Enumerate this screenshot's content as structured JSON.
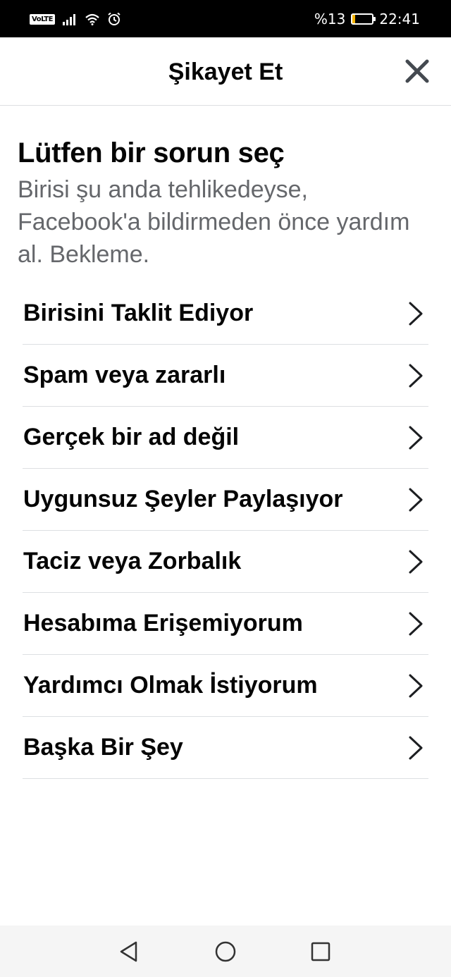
{
  "status_bar": {
    "volte": "VoLTE",
    "battery_text": "%13",
    "battery_level": 0.13,
    "time": "22:41",
    "icons": [
      "signal-icon",
      "wifi-icon",
      "alarm-icon",
      "battery-icon"
    ]
  },
  "header": {
    "title": "Şikayet Et",
    "close_icon": "close-icon"
  },
  "intro": {
    "title": "Lütfen bir sorun seç",
    "subtitle": "Birisi şu anda tehlikedeyse, Facebook'a bildirmeden önce yardım al. Bekleme."
  },
  "options": [
    {
      "label": "Birisini Taklit Ediyor"
    },
    {
      "label": "Spam veya zararlı"
    },
    {
      "label": "Gerçek bir ad değil"
    },
    {
      "label": "Uygunsuz Şeyler Paylaşıyor"
    },
    {
      "label": "Taciz veya Zorbalık"
    },
    {
      "label": "Hesabıma Erişemiyorum"
    },
    {
      "label": "Yardımcı Olmak İstiyorum"
    },
    {
      "label": "Başka Bir Şey"
    }
  ],
  "nav_bar": {
    "icons": [
      "back-icon",
      "home-icon",
      "recents-icon"
    ]
  },
  "colors": {
    "status_bar": "#000000",
    "text_primary": "#050505",
    "text_secondary": "#65676b",
    "divider": "#dddfe2",
    "battery_fill": "#f5b400"
  }
}
